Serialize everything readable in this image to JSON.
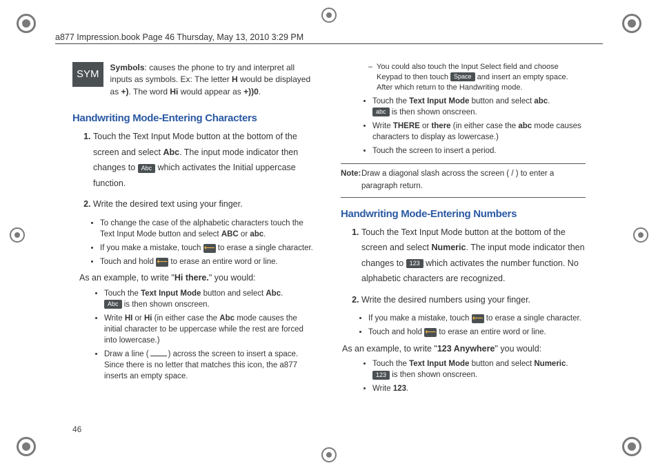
{
  "header": "a877 Impression.book  Page 46  Thursday, May 13, 2010  3:29 PM",
  "page_number": "46",
  "sym": {
    "chip": "SYM",
    "text_a": "Symbols",
    "text_b": ": causes the phone to try and interpret all inputs as symbols. Ex: The letter ",
    "text_c": "H",
    "text_d": " would be displayed as ",
    "text_e": "+)",
    "text_f": ". The word ",
    "text_g": "Hi",
    "text_h": " would appear as ",
    "text_i": "+))0",
    "text_j": "."
  },
  "chars": {
    "heading": "Handwriting Mode-Entering Characters",
    "step1_a": "Touch the Text Input Mode button at the bottom of the screen and select ",
    "step1_b": "Abc",
    "step1_c": ". The input mode indicator then changes to ",
    "step1_d": " which activates the Initial uppercase function.",
    "chip_abc": "Abc",
    "step2": "Write the desired text using your finger.",
    "b1_a": "To change the case of the alphabetic characters touch the Text Input Mode button and select ",
    "b1_b": "ABC",
    "b1_c": " or ",
    "b1_d": "abc",
    "b1_e": ".",
    "b2_a": "If you make a mistake, touch ",
    "b2_b": " to erase a single character.",
    "b3_a": "Touch and hold ",
    "b3_b": " to erase an entire word or line.",
    "ex_intro_a": "As an example, to write \"",
    "ex_intro_b": "Hi there.",
    "ex_intro_c": "\" you would:",
    "ex1_a": "Touch the ",
    "ex1_b": "Text Input Mode",
    "ex1_c": " button and select ",
    "ex1_d": "Abc",
    "ex1_e": ". ",
    "ex1_f": " is then shown onscreen.",
    "ex2_a": "Write ",
    "ex2_b": "HI",
    "ex2_c": " or ",
    "ex2_d": "Hi",
    "ex2_e": " (in either case the ",
    "ex2_f": "Abc",
    "ex2_g": " mode causes the initial character to be uppercase while the rest are forced into lowercase.)",
    "ex3_a": "Draw a line (",
    "ex3_b": ") across the screen to insert a space. Since there is no letter that matches this icon, the a877 inserts an empty space.",
    "sub1_a": "You could also touch the Input Select field and choose Keypad to then touch ",
    "sub1_b": " and insert an empty space. After which return to the Handwriting mode.",
    "chip_space": "Space",
    "ex4_a": "Touch the ",
    "ex4_b": "Text Input Mode",
    "ex4_c": " button and select ",
    "ex4_d": "abc",
    "ex4_e": ". ",
    "ex4_f": " is then shown onscreen.",
    "chip_abc_lower": "abc",
    "ex5_a": "Write ",
    "ex5_b": "THERE",
    "ex5_c": " or ",
    "ex5_d": "there",
    "ex5_e": " (in either case the ",
    "ex5_f": "abc",
    "ex5_g": " mode causes characters to display as lowercase.)",
    "ex6": "Touch the screen to insert a period."
  },
  "note": {
    "label": "Note:",
    "body": " Draw a diagonal slash across the screen ( / ) to enter a paragraph return."
  },
  "nums": {
    "heading": "Handwriting Mode-Entering Numbers",
    "step1_a": "Touch the Text Input Mode button at the bottom of the screen and select ",
    "step1_b": "Numeric",
    "step1_c": ". The input mode indicator then changes to ",
    "step1_d": " which activates the number function. No alphabetic characters are recognized.",
    "chip_123": "123",
    "step2": "Write the desired numbers using your finger.",
    "b1_a": "If you make a mistake, touch ",
    "b1_b": " to erase a single character.",
    "b2_a": "Touch and hold ",
    "b2_b": " to erase an entire word or line.",
    "ex_intro_a": "As an example, to write \"",
    "ex_intro_b": "123 Anywhere",
    "ex_intro_c": "\" you would:",
    "ex1_a": "Touch the ",
    "ex1_b": "Text Input Mode",
    "ex1_c": " button and select ",
    "ex1_d": "Numeric",
    "ex1_e": ". ",
    "ex1_f": " is then shown onscreen.",
    "ex2_a": "Write ",
    "ex2_b": "123",
    "ex2_c": "."
  }
}
